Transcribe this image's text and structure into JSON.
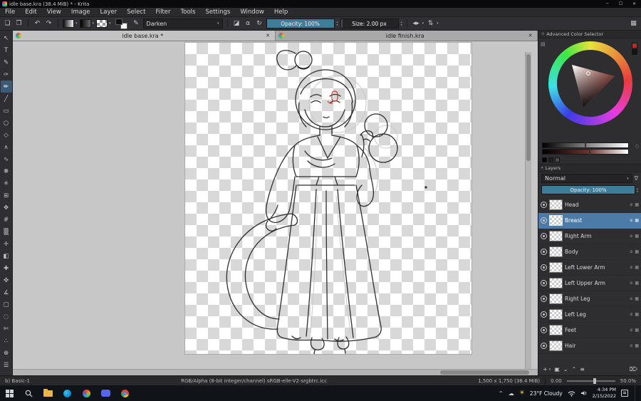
{
  "titlebar": {
    "title": "idle base.kra (38.4 MiB) * - Krita",
    "minimize": "─",
    "maximize": "☐",
    "close": "✕"
  },
  "menubar": {
    "items": [
      "File",
      "Edit",
      "View",
      "Image",
      "Layer",
      "Select",
      "Filter",
      "Tools",
      "Settings",
      "Window",
      "Help"
    ]
  },
  "toolbar": {
    "new_doc": "❏",
    "open_doc": "❐",
    "undo": "↶",
    "redo": "↷",
    "brush_editor": "✎",
    "blend_mode": "Darken",
    "eraser": "◪",
    "alpha_lock": "α",
    "reload": "↻",
    "opacity_text": "Opacity: 100%",
    "size_text": "Size: 2.00 px",
    "mirror_h": "◂▸",
    "mirror_v": "⇅",
    "dropdown": "▾",
    "workspace": "▦",
    "accent_color": "#3e7d99"
  },
  "tabs": [
    {
      "title": "idle base.kra *",
      "active": true
    },
    {
      "title": "idle finish.kra",
      "active": false
    }
  ],
  "tab_close": "✕",
  "toolbox": [
    {
      "name": "select-shapes-tool",
      "glyph": "↖",
      "selected": false
    },
    {
      "name": "text-tool",
      "glyph": "T",
      "selected": false
    },
    {
      "name": "edit-shapes-tool",
      "glyph": "✎",
      "selected": false
    },
    {
      "name": "calligraphy-tool",
      "glyph": "✑",
      "selected": false
    },
    {
      "name": "freehand-brush-tool",
      "glyph": "✏",
      "selected": true
    },
    {
      "name": "line-tool",
      "glyph": "╱",
      "selected": false
    },
    {
      "name": "rectangle-tool",
      "glyph": "▭",
      "selected": false
    },
    {
      "name": "ellipse-tool",
      "glyph": "○",
      "selected": false
    },
    {
      "name": "polygon-tool",
      "glyph": "◇",
      "selected": false
    },
    {
      "name": "polyline-tool",
      "glyph": "∧",
      "selected": false
    },
    {
      "name": "bezier-curve-tool",
      "glyph": "∿",
      "selected": false
    },
    {
      "name": "dynamic-brush-tool",
      "glyph": "❋",
      "selected": false
    },
    {
      "name": "multibrush-tool",
      "glyph": "✳",
      "selected": false
    },
    {
      "name": "transform-tool",
      "glyph": "⊞",
      "selected": false
    },
    {
      "name": "move-tool",
      "glyph": "✥",
      "selected": false
    },
    {
      "name": "crop-tool",
      "glyph": "#",
      "selected": false
    },
    {
      "name": "gradient-tool",
      "glyph": "▒",
      "selected": false
    },
    {
      "name": "color-sampler-tool",
      "glyph": "✛",
      "selected": false
    },
    {
      "name": "fill-tool",
      "glyph": "◧",
      "selected": false
    },
    {
      "name": "smart-patch-tool",
      "glyph": "✚",
      "selected": false
    },
    {
      "name": "assistants-tool",
      "glyph": "✜",
      "selected": false
    },
    {
      "name": "measure-tool",
      "glyph": "∡",
      "selected": false
    },
    {
      "name": "rectangular-selection-tool",
      "glyph": "▢",
      "selected": false
    },
    {
      "name": "elliptical-selection-tool",
      "glyph": "◌",
      "selected": false
    },
    {
      "name": "freehand-selection-tool",
      "glyph": "✄",
      "selected": false
    },
    {
      "name": "contiguous-selection-tool",
      "glyph": "∴",
      "selected": false
    },
    {
      "name": "zoom-tool",
      "glyph": "⊕",
      "selected": false
    },
    {
      "name": "pan-tool",
      "glyph": "☰",
      "selected": false
    }
  ],
  "color_docker": {
    "collapse_icon": "⊙",
    "title": "Advanced Color Selector",
    "settings_icon": "▤",
    "shade_reset_icon": "○"
  },
  "layers_docker": {
    "collapse_icon": "▾",
    "title": "Layers",
    "blend_mode": "Normal",
    "blend_arrow": "▾",
    "filter_icon": "∇",
    "opacity_text": "Opacity:  100%",
    "alpha_icon": "α",
    "mask_icon": "▦",
    "rows": [
      {
        "name": "Head",
        "selected": false
      },
      {
        "name": "Breast",
        "selected": true
      },
      {
        "name": "Right Arm",
        "selected": false
      },
      {
        "name": "Body",
        "selected": false
      },
      {
        "name": "Left Lower Arm",
        "selected": false
      },
      {
        "name": "Left Upper Arm",
        "selected": false
      },
      {
        "name": "Right Leg",
        "selected": false
      },
      {
        "name": "Left Leg",
        "selected": false
      },
      {
        "name": "Feet",
        "selected": false
      },
      {
        "name": "Hair",
        "selected": false
      }
    ],
    "footer": {
      "add": "+",
      "add_arrow": "▾",
      "duplicate": "▣",
      "move_down": "⌄",
      "move_up": "⌃",
      "properties": "≡",
      "delete": "⌦"
    },
    "selected_color": "#4d7ba7"
  },
  "statusbar": {
    "brush_preset": "b) Basic-1",
    "color_profile": "RGB/Alpha (8-bit integer/channel)  sRGB-elle-V2-srgbtrc.icc",
    "canvas_size": "1,500 x 1,750 (38.4 MiB)",
    "angle": "0.00",
    "zoom": "50.0%"
  },
  "taskbar": {
    "tray_chevron": "⌃",
    "cloud_icon": "☁",
    "sun_icon": "☀",
    "weather": "23°F Cloudy",
    "time": "4:34 PM",
    "date": "2/15/2022"
  }
}
